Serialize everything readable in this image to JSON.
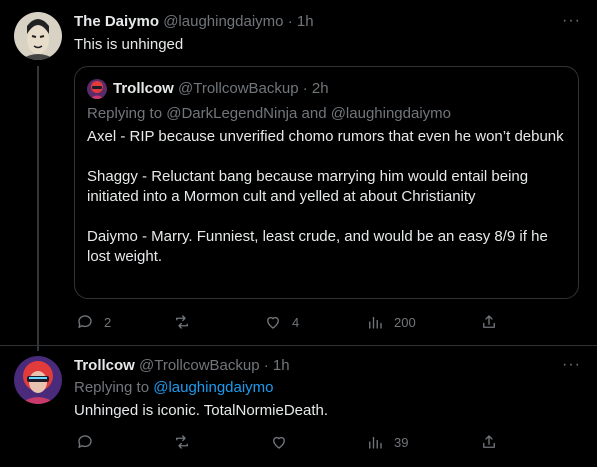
{
  "tweet1": {
    "name": "The Daiymo",
    "handle": "@laughingdaiymo",
    "time": "· 1h",
    "text": "This is unhinged",
    "more": "···",
    "quote": {
      "name": "Trollcow",
      "handle": "@TrollcowBackup",
      "time": "· 2h",
      "replying": "Replying to @DarkLegendNinja and @laughingdaiymo",
      "paragraphs": [
        "Axel - RIP because unverified chomo rumors that even he won’t debunk",
        "Shaggy - Reluctant bang because marrying him would entail being initiated into a Mormon cult and yelled at about Christianity",
        "Daiymo - Marry. Funniest, least crude, and would be an easy 8/9 if he lost weight."
      ]
    },
    "stats": {
      "replies": "2",
      "retweets": "",
      "likes": "4",
      "views": "200"
    }
  },
  "tweet2": {
    "name": "Trollcow",
    "handle": "@TrollcowBackup",
    "time": "· 1h",
    "replying_prefix": "Replying to",
    "replying_handle": "@laughingdaiymo",
    "text": "Unhinged is iconic. TotalNormieDeath.",
    "more": "···",
    "stats": {
      "replies": "",
      "retweets": "",
      "likes": "",
      "views": "39"
    }
  },
  "colors": {
    "background": "#000000",
    "text": "#e7e9ea",
    "muted": "#71767b",
    "link": "#1d9bf0",
    "border": "#2f3336"
  }
}
